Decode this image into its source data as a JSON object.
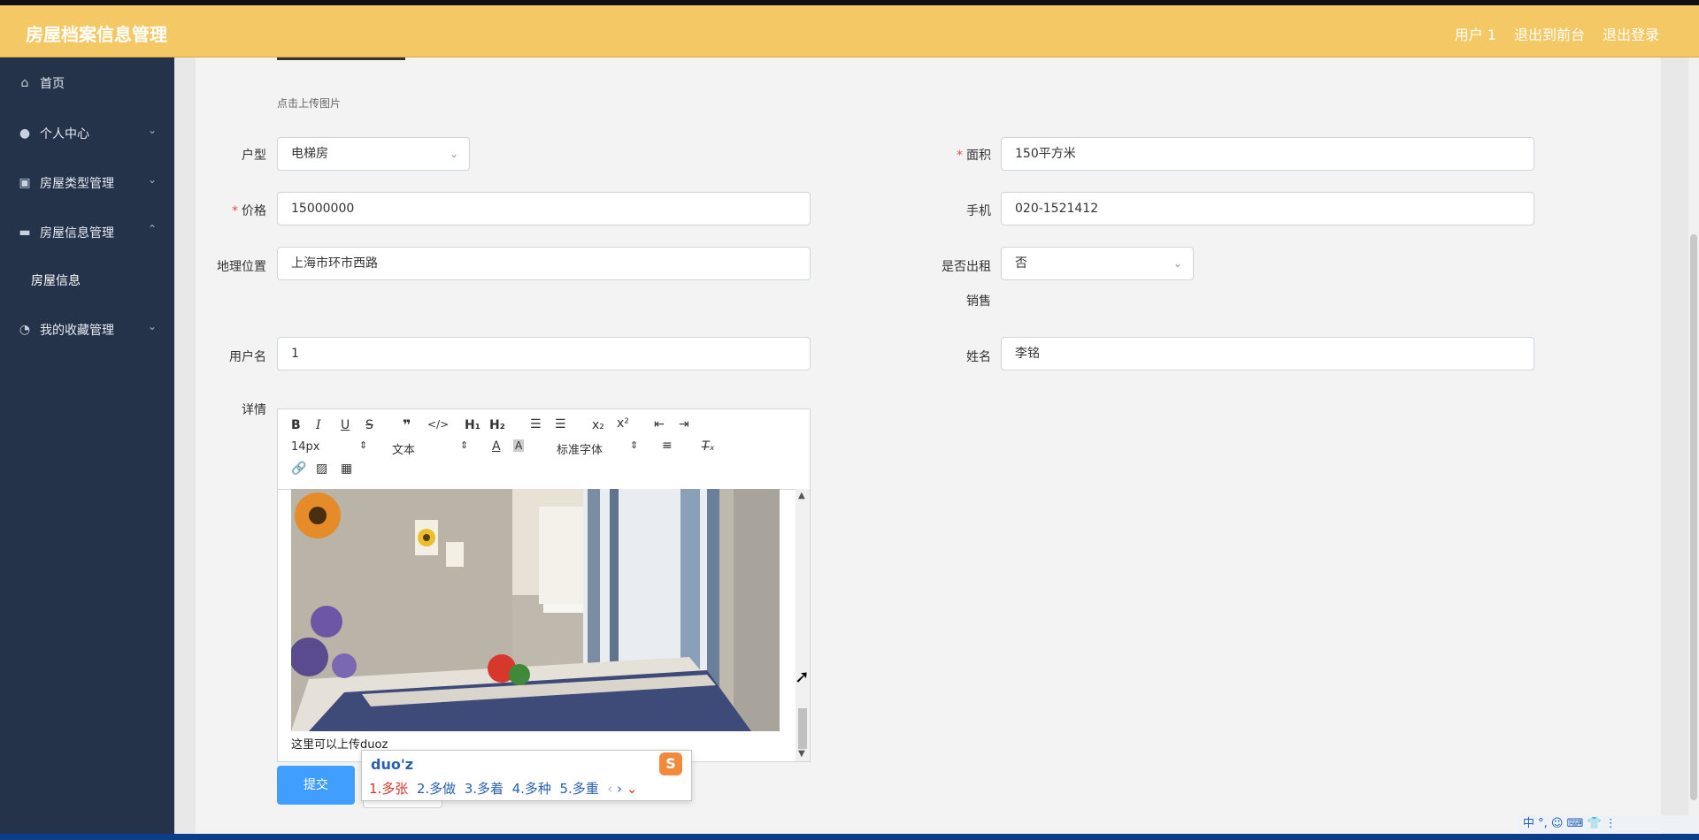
{
  "header": {
    "title": "房屋档案信息管理",
    "user": "用户 1",
    "back_front": "退出到前台",
    "logout": "退出登录"
  },
  "sidebar": {
    "items": [
      {
        "label": "首页",
        "icon": "home-icon"
      },
      {
        "label": "个人中心",
        "icon": "user-icon"
      },
      {
        "label": "房屋类型管理",
        "icon": "clipboard-icon"
      },
      {
        "label": "房屋信息管理",
        "icon": "sign-icon"
      },
      {
        "label": "我的收藏管理",
        "icon": "gauge-icon"
      }
    ],
    "sub_item": "房屋信息"
  },
  "form": {
    "upload_hint": "点击上传图片",
    "house_type": {
      "label": "户型",
      "value": "电梯房"
    },
    "area": {
      "label": "面积",
      "value": "150平方米"
    },
    "price": {
      "label": "价格",
      "value": "15000000"
    },
    "phone": {
      "label": "手机",
      "value": "020-1521412"
    },
    "location": {
      "label": "地理位置",
      "value": "上海市环市西路"
    },
    "is_rented": {
      "label": "是否出租",
      "value": "否"
    },
    "sale": {
      "label": "销售"
    },
    "username": {
      "label": "用户名",
      "value": "1"
    },
    "name": {
      "label": "姓名",
      "value": "李铭"
    },
    "details": {
      "label": "详情"
    },
    "submit": "提交"
  },
  "editor": {
    "font_size": "14px",
    "text_style": "文本",
    "font_family": "标准字体",
    "content_text": "这里可以上传duoz"
  },
  "ime": {
    "composition": "duo'z",
    "candidates": [
      "1.多张",
      "2.多做",
      "3.多着",
      "4.多种",
      "5.多重"
    ],
    "logo": "S"
  },
  "tray": {
    "text": "中 °, ☺ ⌨ 👕 ⋮"
  }
}
